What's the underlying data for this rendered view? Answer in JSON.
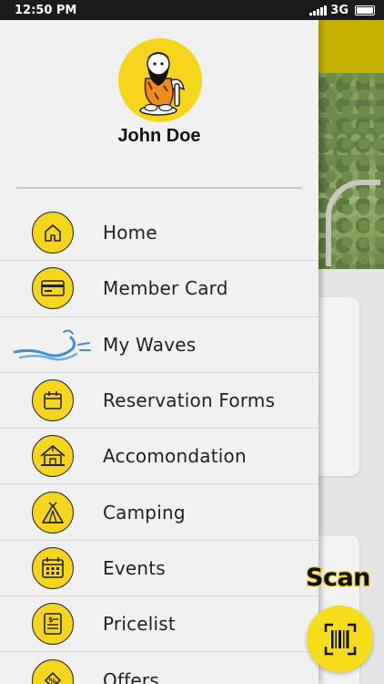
{
  "status_bar": {
    "time": "12:50 PM",
    "network": "3G"
  },
  "user": {
    "name": "John Doe",
    "avatar_icon": "caveman-avatar-icon"
  },
  "menu": [
    {
      "label": "Home",
      "icon": "home-icon"
    },
    {
      "label": "Member Card",
      "icon": "card-icon"
    },
    {
      "label": "My Waves",
      "icon": "wave-icon"
    },
    {
      "label": "Reservation Forms",
      "icon": "calendar-icon"
    },
    {
      "label": "Accomondation",
      "icon": "bungalow-icon"
    },
    {
      "label": "Camping",
      "icon": "tent-icon"
    },
    {
      "label": "Events",
      "icon": "events-calendar-icon"
    },
    {
      "label": "Pricelist",
      "icon": "pricelist-icon"
    },
    {
      "label": "Offers",
      "icon": "percent-tag-icon"
    }
  ],
  "scan": {
    "label": "Scan",
    "icon": "barcode-icon"
  },
  "colors": {
    "accent": "#f7d51d",
    "header": "#c9b100",
    "drawer_bg": "#f1f1f1"
  }
}
